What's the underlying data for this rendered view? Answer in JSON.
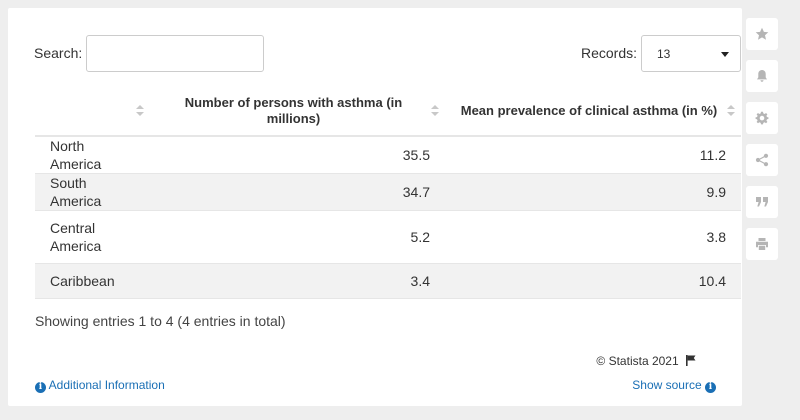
{
  "search": {
    "label": "Search:",
    "value": "",
    "placeholder": ""
  },
  "records": {
    "label": "Records:",
    "selected": "13"
  },
  "table": {
    "headers": [
      "",
      "Number of persons with asthma (in millions)",
      "Mean prevalence of clinical asthma (in %)"
    ],
    "rows": [
      {
        "region": "North America",
        "persons": "35.5",
        "prevalence": "11.2"
      },
      {
        "region": "South America",
        "persons": "34.7",
        "prevalence": "9.9"
      },
      {
        "region": "Central America",
        "persons": "5.2",
        "prevalence": "3.8"
      },
      {
        "region": "Caribbean",
        "persons": "3.4",
        "prevalence": "10.4"
      }
    ]
  },
  "footer": {
    "showing": "Showing entries 1 to 4 (4 entries in total)",
    "copyright": "© Statista 2021",
    "additional_info": "Additional Information",
    "show_source": "Show source"
  },
  "sidebar": {
    "icons": [
      "star-icon",
      "bell-icon",
      "gear-icon",
      "share-icon",
      "quote-icon",
      "print-icon"
    ]
  },
  "colors": {
    "link": "#1a6fb5",
    "stripe": "#f2f2f2",
    "background": "#eeeeee"
  }
}
